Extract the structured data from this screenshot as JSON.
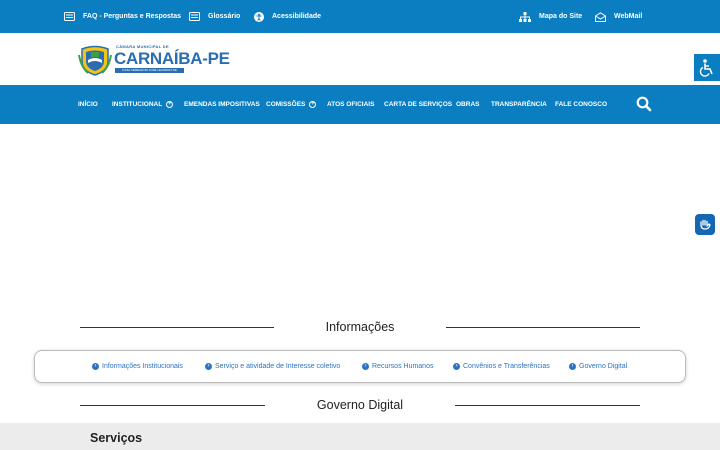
{
  "topbar": {
    "faq_label": "FAQ - Perguntas e Respostas",
    "glossary_label": "Glossário",
    "accessibility_label": "Acessibilidade",
    "sitemap_label": "Mapa do Site",
    "webmail_label": "WebMail"
  },
  "logo": {
    "small_text": "CÂMARA MUNICIPAL DE",
    "main_text": "CARNAÍBA-PE",
    "strip_text": "CASA VEREADOR JOSÉ LEANDRO DE OLIVEIRA"
  },
  "nav": {
    "items": [
      {
        "label": "INÍCIO"
      },
      {
        "label": "INSTITUCIONAL"
      },
      {
        "label": "EMENDAS IMPOSITIVAS"
      },
      {
        "label": "COMISSÕES"
      },
      {
        "label": "ATOS OFICIAIS"
      },
      {
        "label": "CARTA DE SERVIÇOS"
      },
      {
        "label": "OBRAS"
      },
      {
        "label": "TRANSPARÊNCIA"
      },
      {
        "label": "FALE CONOSCO"
      }
    ]
  },
  "sections": {
    "informacoes_title": "Informações",
    "governo_title": "Governo Digital",
    "servicos_title": "Serviços"
  },
  "info_links": [
    {
      "label": "Informações Institucionais"
    },
    {
      "label": "Serviço e atividade de Interesse coletivo"
    },
    {
      "label": "Recursos Humanos"
    },
    {
      "label": "Convênios e Transferências"
    },
    {
      "label": "Governo Digital"
    }
  ],
  "colors": {
    "primary": "#0b7ec2",
    "link": "#2a73c2",
    "services_bg": "#ececec"
  }
}
